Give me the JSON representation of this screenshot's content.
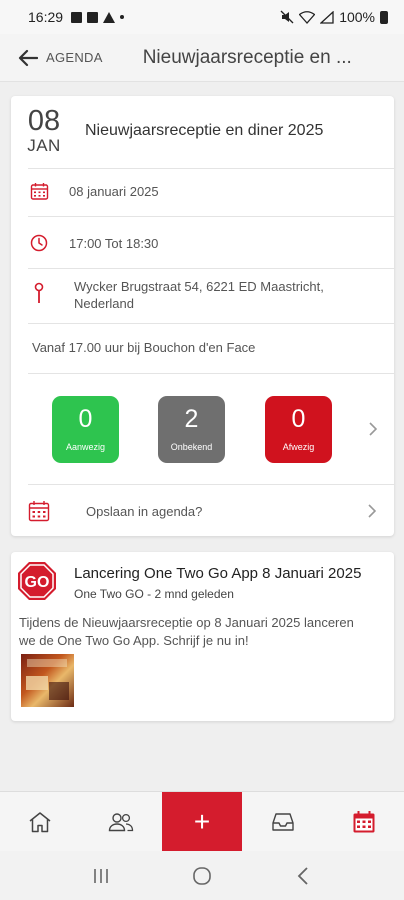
{
  "status_bar": {
    "time": "16:29",
    "battery": "100%"
  },
  "header": {
    "back_label": "AGENDA",
    "title": "Nieuwjaarsreceptie en ..."
  },
  "event": {
    "day": "08",
    "month": "JAN",
    "title": "Nieuwjaarsreceptie en diner 2025",
    "date": "08 januari 2025",
    "time": "17:00 Tot 18:30",
    "address": "Wycker Brugstraat 54, 6221 ED Maastricht, Nederland",
    "note": "Vanaf 17.00 uur bij Bouchon d'en Face",
    "attendance": [
      {
        "count": "0",
        "label": "Aanwezig",
        "color": "#2ec44f"
      },
      {
        "count": "2",
        "label": "Onbekend",
        "color": "#6f6f6f"
      },
      {
        "count": "0",
        "label": "Afwezig",
        "color": "#d0121e"
      }
    ],
    "save_label": "Opslaan in agenda?"
  },
  "news": {
    "logo_text": "GO",
    "title": "Lancering One Two Go App 8 Januari 2025",
    "meta": "One Two GO - 2 mnd geleden",
    "body": "Tijdens de Nieuwjaarsreceptie op 8 Januari 2025 lanceren we de One Two Go App. Schrijf je nu in!"
  },
  "bottom_nav": {
    "items": [
      "home-icon",
      "people-icon",
      "add-icon",
      "inbox-icon",
      "calendar-icon"
    ],
    "add_symbol": "+"
  },
  "colors": {
    "accent": "#d41c2d",
    "present": "#2ec44f",
    "unknown": "#6f6f6f",
    "absent": "#d0121e"
  }
}
